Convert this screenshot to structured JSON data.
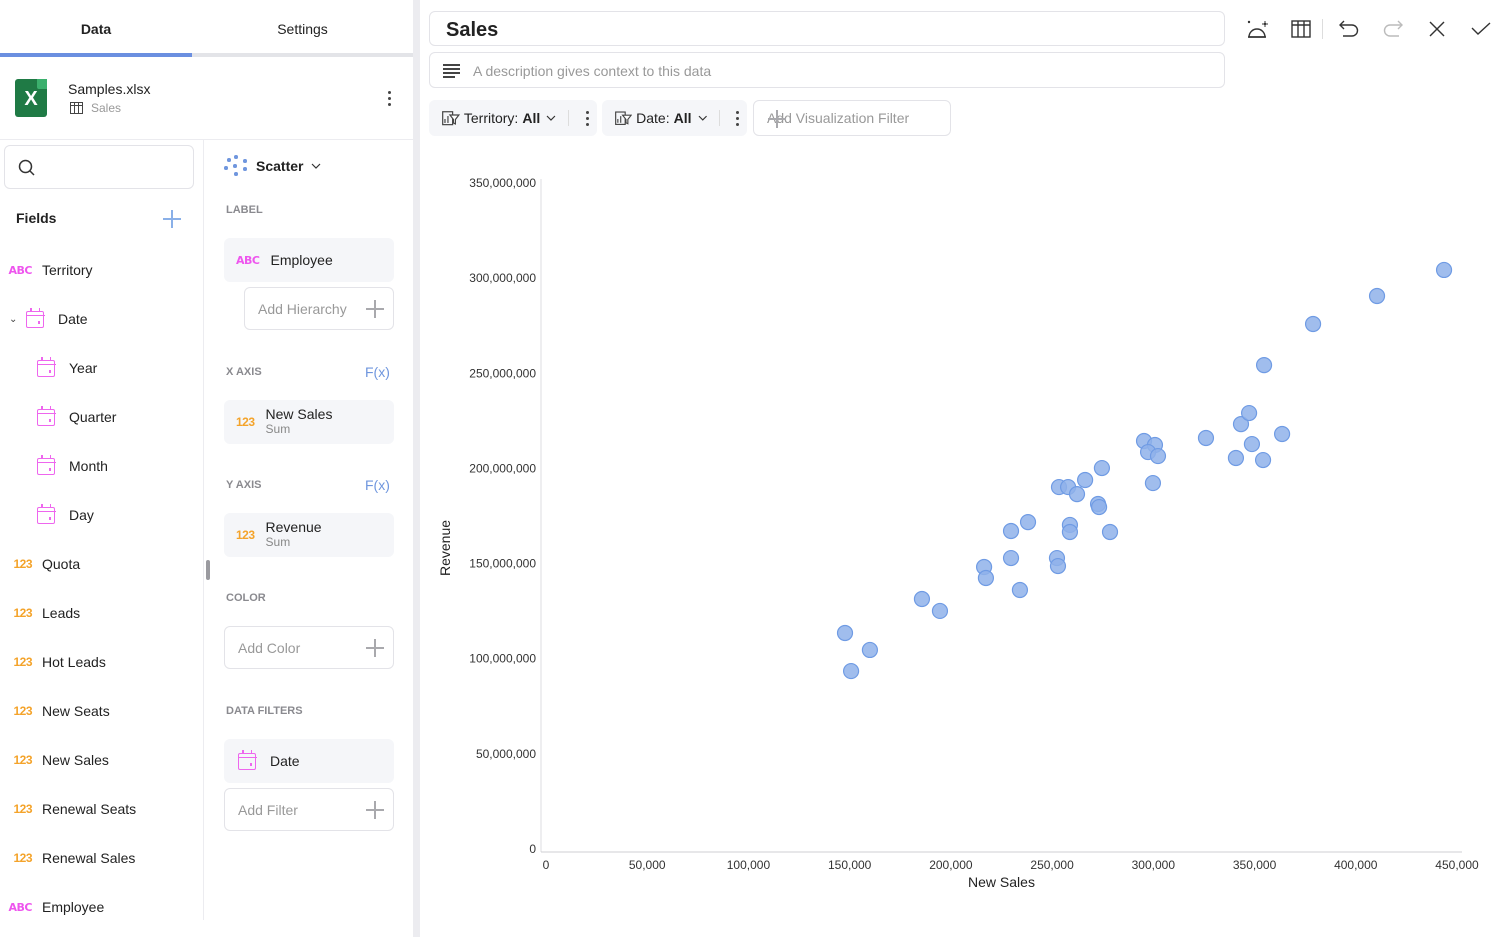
{
  "left_panel": {
    "tabs": [
      {
        "label": "Data",
        "active": true
      },
      {
        "label": "Settings",
        "active": false
      }
    ],
    "source": {
      "file_name": "Samples.xlsx",
      "sheet_name": "Sales",
      "icon": "excel-icon",
      "icon_letter": "X"
    },
    "search": {
      "placeholder": "",
      "value": ""
    },
    "fields_title": "Fields",
    "fields": [
      {
        "label": "Territory",
        "type": "ABC"
      },
      {
        "label": "Date",
        "type": "date",
        "expanded": true
      },
      {
        "label": "Year",
        "type": "date",
        "child": true
      },
      {
        "label": "Quarter",
        "type": "date",
        "child": true
      },
      {
        "label": "Month",
        "type": "date",
        "child": true
      },
      {
        "label": "Day",
        "type": "date",
        "child": true
      },
      {
        "label": "Quota",
        "type": "123"
      },
      {
        "label": "Leads",
        "type": "123"
      },
      {
        "label": "Hot Leads",
        "type": "123"
      },
      {
        "label": "New Seats",
        "type": "123"
      },
      {
        "label": "New Sales",
        "type": "123"
      },
      {
        "label": "Renewal Seats",
        "type": "123"
      },
      {
        "label": "Renewal Sales",
        "type": "123"
      },
      {
        "label": "Employee",
        "type": "ABC"
      }
    ],
    "config": {
      "viz_type": "Scatter",
      "label_section": "LABEL",
      "label_field": {
        "type": "ABC",
        "name": "Employee"
      },
      "add_hierarchy": "Add Hierarchy",
      "x_axis_section": "X AXIS",
      "x_axis_field": {
        "type": "123",
        "name": "New Sales",
        "agg": "Sum"
      },
      "y_axis_section": "Y AXIS",
      "y_axis_field": {
        "type": "123",
        "name": "Revenue",
        "agg": "Sum"
      },
      "fx_label": "F(x)",
      "color_section": "COLOR",
      "add_color": "Add Color",
      "data_filters_section": "DATA FILTERS",
      "filter_field": {
        "type": "date",
        "name": "Date"
      },
      "add_filter": "Add Filter"
    }
  },
  "editor": {
    "title": "Sales",
    "description_placeholder": "A description gives context to this data",
    "toolbar": [
      "magic-theme-icon",
      "table-view-icon",
      "undo-icon",
      "redo-icon",
      "close-icon",
      "check-icon"
    ],
    "filters": [
      {
        "label": "Territory:",
        "value": "All"
      },
      {
        "label": "Date:",
        "value": "All"
      }
    ],
    "add_viz_filter": "Add Visualization Filter"
  },
  "colors": {
    "accent": "#6b8fe0",
    "point_fill": "#8fb2ea",
    "point_stroke": "#6f9be4",
    "abc_type": "#ee55ee",
    "num_type": "#f4a32a",
    "excel_green": "#1f7a45"
  },
  "chart_data": {
    "type": "scatter",
    "title": "",
    "xlabel": "New Sales",
    "ylabel": "Revenue",
    "xlim": [
      0,
      450000
    ],
    "ylim": [
      0,
      350000000
    ],
    "x_ticks": [
      0,
      50000,
      100000,
      150000,
      200000,
      250000,
      300000,
      350000,
      400000,
      450000
    ],
    "x_tick_labels": [
      "0",
      "50,000",
      "100,000",
      "150,000",
      "200,000",
      "250,000",
      "300,000",
      "350,000",
      "400,000",
      "450,000"
    ],
    "y_ticks": [
      0,
      50000000,
      100000000,
      150000000,
      200000000,
      250000000,
      300000000,
      350000000
    ],
    "y_tick_labels": [
      "0",
      "50,000,000",
      "100,000,000",
      "150,000,000",
      "200,000,000",
      "250,000,000",
      "300,000,000",
      "350,000,000"
    ],
    "grid": false,
    "legend": "none",
    "points": [
      {
        "x": 147700,
        "y": 113500000
      },
      {
        "x": 160000,
        "y": 104600000
      },
      {
        "x": 150700,
        "y": 93500000
      },
      {
        "x": 185700,
        "y": 131400000
      },
      {
        "x": 194600,
        "y": 125100000
      },
      {
        "x": 216400,
        "y": 148200000
      },
      {
        "x": 217300,
        "y": 142400000
      },
      {
        "x": 229700,
        "y": 152900000
      },
      {
        "x": 229700,
        "y": 167100000
      },
      {
        "x": 238100,
        "y": 171800000
      },
      {
        "x": 234100,
        "y": 136100000
      },
      {
        "x": 252400,
        "y": 152900000
      },
      {
        "x": 252900,
        "y": 148700000
      },
      {
        "x": 258800,
        "y": 170300000
      },
      {
        "x": 258800,
        "y": 166600000
      },
      {
        "x": 272700,
        "y": 181300000
      },
      {
        "x": 273200,
        "y": 179700000
      },
      {
        "x": 278600,
        "y": 166600000
      },
      {
        "x": 253400,
        "y": 190200000
      },
      {
        "x": 257900,
        "y": 190200000
      },
      {
        "x": 262300,
        "y": 186500000
      },
      {
        "x": 266300,
        "y": 193900000
      },
      {
        "x": 274600,
        "y": 200200000
      },
      {
        "x": 299800,
        "y": 192300000
      },
      {
        "x": 295400,
        "y": 214400000
      },
      {
        "x": 300800,
        "y": 212300000
      },
      {
        "x": 297400,
        "y": 208600000
      },
      {
        "x": 302300,
        "y": 206500000
      },
      {
        "x": 326000,
        "y": 216000000
      },
      {
        "x": 340800,
        "y": 205500000
      },
      {
        "x": 343300,
        "y": 223300000
      },
      {
        "x": 347300,
        "y": 229100000
      },
      {
        "x": 348700,
        "y": 212800000
      },
      {
        "x": 354200,
        "y": 204400000
      },
      {
        "x": 354700,
        "y": 254300000
      },
      {
        "x": 363600,
        "y": 218100000
      },
      {
        "x": 378900,
        "y": 275900000
      },
      {
        "x": 410500,
        "y": 290600000
      },
      {
        "x": 443600,
        "y": 304300000
      }
    ]
  }
}
